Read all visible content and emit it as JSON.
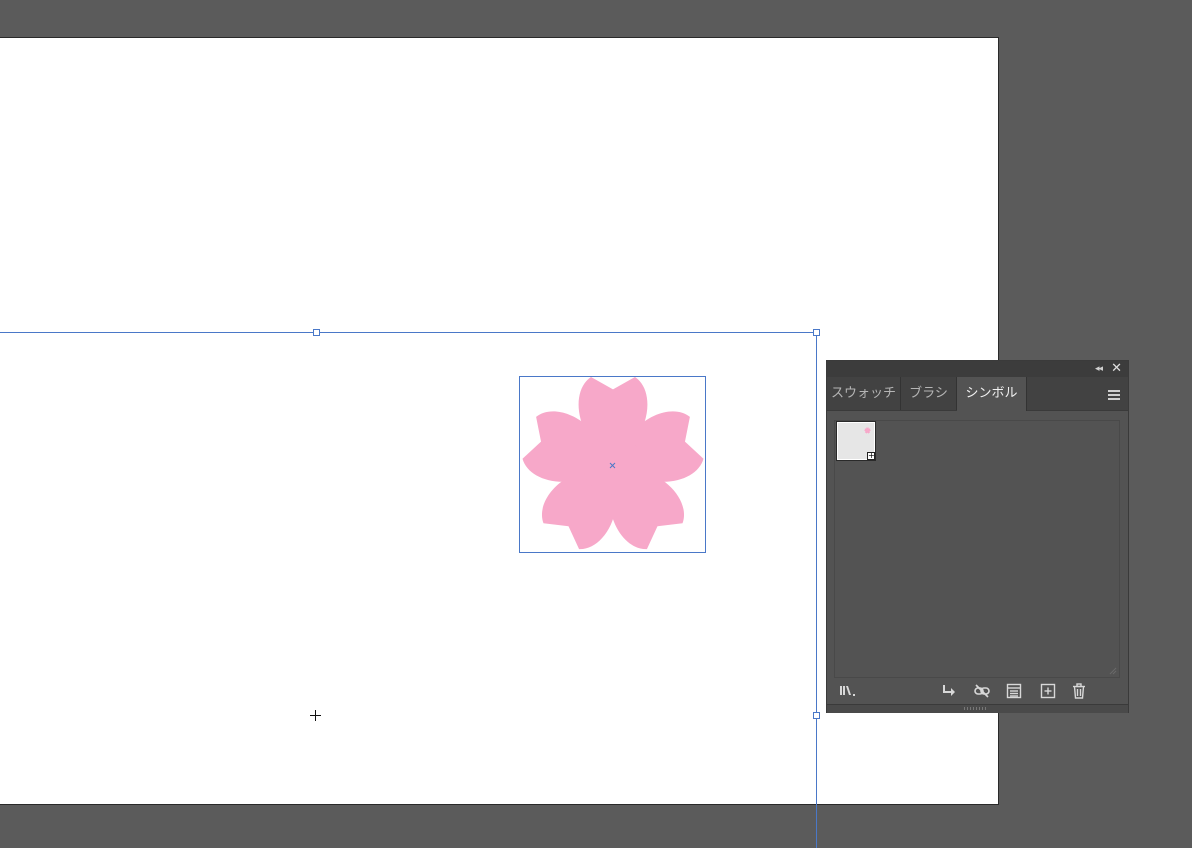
{
  "canvas": {
    "background": "#5b5b5b",
    "artboard_color": "#ffffff",
    "selection_color": "#4a78c8"
  },
  "symbol_instance": {
    "name": "sakura-flower",
    "fill": "#f7a8c9"
  },
  "panel": {
    "tabs": [
      {
        "label": "スウォッチ",
        "active": false
      },
      {
        "label": "ブラシ",
        "active": false
      },
      {
        "label": "シンボル",
        "active": true
      }
    ],
    "collapse_glyph": "◂◂",
    "close_glyph": "✕",
    "menu_icon": "hamburger-menu-icon",
    "symbols": [
      {
        "name": "sakura",
        "thumb_bg": "#e6e6e6",
        "color": "#f7a8c9"
      }
    ],
    "footer_icons": [
      "symbol-library-icon",
      "place-symbol-instance-icon",
      "break-link-icon",
      "symbol-options-icon",
      "new-symbol-icon",
      "delete-symbol-icon"
    ]
  }
}
